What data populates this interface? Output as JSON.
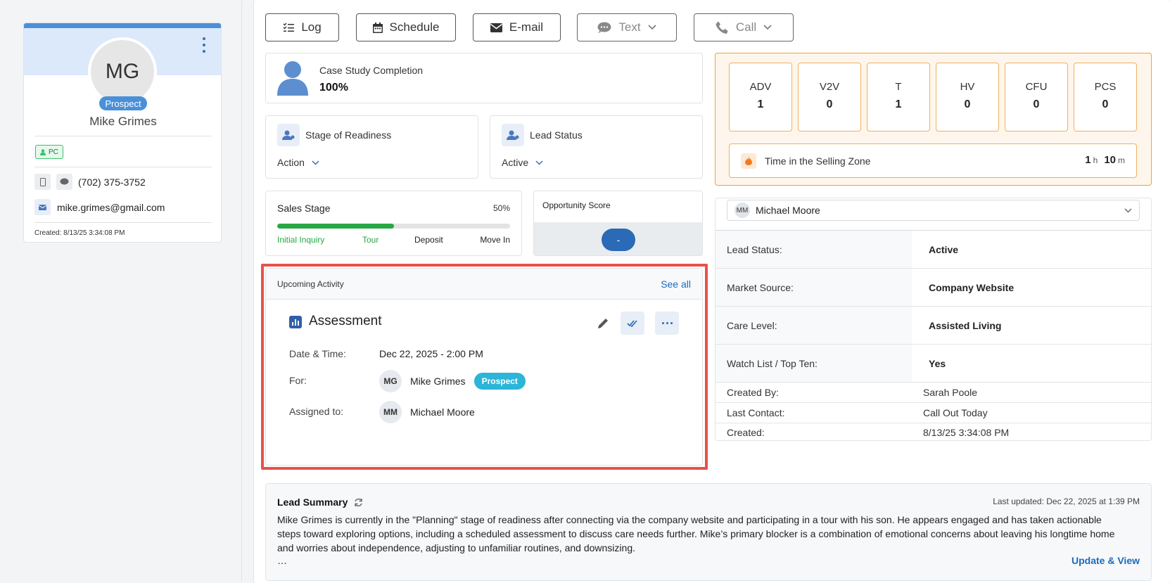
{
  "profile": {
    "initials": "MG",
    "badge": "Prospect",
    "name": "Mike Grimes",
    "tag": "PC",
    "phone": "(702) 375-3752",
    "email": "mike.grimes@gmail.com",
    "created": "Created: 8/13/25 3:34:08 PM"
  },
  "toolbar": {
    "log": "Log",
    "schedule": "Schedule",
    "email": "E-mail",
    "text": "Text",
    "call": "Call"
  },
  "case_study": {
    "label": "Case Study Completion",
    "value": "100%"
  },
  "stage_readiness": {
    "label": "Stage of Readiness",
    "value": "Action"
  },
  "lead_status_card": {
    "label": "Lead Status",
    "value": "Active"
  },
  "sales_stage": {
    "label": "Sales Stage",
    "percent": "50%",
    "progress": 0.5,
    "steps": [
      "Initial Inquiry",
      "Tour",
      "Deposit",
      "Move In"
    ]
  },
  "opportunity": {
    "label": "Opportunity Score",
    "value": "-"
  },
  "upcoming": {
    "title": "Upcoming Activity",
    "see_all": "See all",
    "activity": "Assessment",
    "date_label": "Date & Time:",
    "date_value": "Dec 22, 2025 - 2:00 PM",
    "for_label": "For:",
    "for_initials": "MG",
    "for_name": "Mike Grimes",
    "for_badge": "Prospect",
    "assigned_label": "Assigned to:",
    "assigned_initials": "MM",
    "assigned_name": "Michael Moore"
  },
  "stats": [
    {
      "label": "ADV",
      "value": "1"
    },
    {
      "label": "V2V",
      "value": "0"
    },
    {
      "label": "T",
      "value": "1"
    },
    {
      "label": "HV",
      "value": "0"
    },
    {
      "label": "CFU",
      "value": "0"
    },
    {
      "label": "PCS",
      "value": "0"
    }
  ],
  "selling_zone": {
    "label": "Time in the Selling Zone",
    "hours": "1",
    "h": "h",
    "minutes": "10",
    "m": "m"
  },
  "owner": {
    "initials": "MM",
    "name": "Michael Moore"
  },
  "details": [
    {
      "key": "Lead Status:",
      "value": "Active"
    },
    {
      "key": "Market Source:",
      "value": "Company Website"
    },
    {
      "key": "Care Level:",
      "value": "Assisted Living"
    },
    {
      "key": "Watch List / Top Ten:",
      "value": "Yes"
    },
    {
      "key": "Created By:",
      "value": "Sarah Poole"
    },
    {
      "key": "Last Contact:",
      "value": "Call Out Today"
    },
    {
      "key": "Created:",
      "value": "8/13/25 3:34:08 PM"
    }
  ],
  "summary": {
    "title": "Lead Summary",
    "updated": "Last updated: Dec 22, 2025 at 1:39 PM",
    "text": "Mike Grimes is currently in the \"Planning\" stage of readiness after connecting via the company website and participating in a tour with his son. He appears engaged and has taken actionable steps toward exploring options, including a scheduled assessment to discuss care needs further. Mike’s primary blocker is a combination of emotional concerns about leaving his longtime home and worries about independence, adjusting to unfamiliar routines, and downsizing.",
    "ellipsis": "…",
    "link": "Update & View"
  },
  "colors": {
    "primary": "#4a90d9",
    "accent_orange": "#f0a040",
    "progress_green": "#28a745",
    "prospect_badge": "#2bb5d8",
    "highlight_red": "#e8524a"
  }
}
